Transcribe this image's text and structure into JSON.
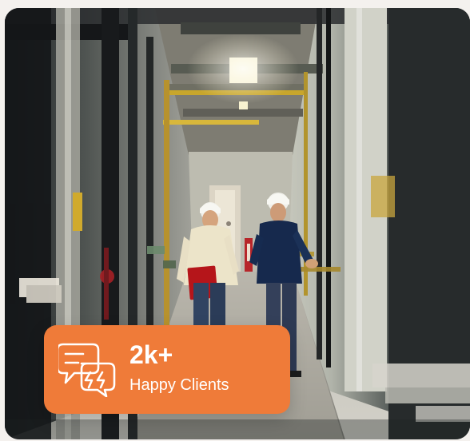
{
  "hero": {
    "stat": {
      "value": "2k+",
      "label": "Happy Clients",
      "icon": "chat-bubbles-icon",
      "accent": "#ef7b39",
      "text_color": "#ffffff"
    }
  }
}
